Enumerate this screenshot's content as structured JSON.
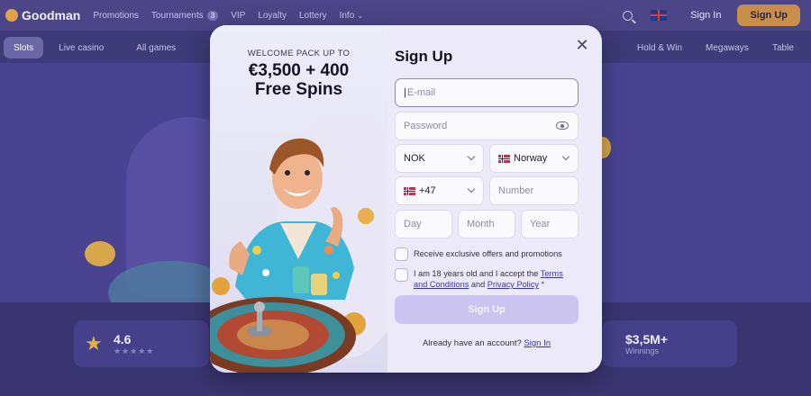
{
  "header": {
    "logo_text": "Goodman",
    "nav": [
      {
        "label": "Promotions"
      },
      {
        "label": "Tournaments",
        "badge": "3"
      },
      {
        "label": "VIP"
      },
      {
        "label": "Loyalty"
      },
      {
        "label": "Lottery"
      },
      {
        "label": "Info"
      }
    ],
    "login_label": "Sign In",
    "signup_label": "Sign Up"
  },
  "categories": [
    "Slots",
    "Live casino",
    "All games",
    "Hold & Win",
    "Megaways",
    "Table"
  ],
  "stats": {
    "rating_value": "4.6",
    "rating_stars": "★★★★★",
    "winnings_value": "$3,5M+",
    "winnings_label": "Winnings"
  },
  "modal": {
    "promo_kicker": "WELCOME PACK UP TO",
    "promo_title_line1": "€3,500 + 400",
    "promo_title_line2": "Free Spins",
    "title": "Sign Up",
    "email_placeholder": "E-mail",
    "password_placeholder": "Password",
    "currency_value": "NOK",
    "country_value": "Norway",
    "phone_code": "+47",
    "number_placeholder": "Number",
    "day_placeholder": "Day",
    "month_placeholder": "Month",
    "year_placeholder": "Year",
    "offers_label": "Receive exclusive offers and promotions",
    "age_text_1": "I am 18 years old and I accept the",
    "terms_link": "Terms and Conditions",
    "age_text_2": "and",
    "privacy_link": "Privacy Policy",
    "required_mark": "*",
    "submit_label": "Sign Up",
    "have_account_text": "Already have an account?",
    "signin_link": "Sign In",
    "close_glyph": "✕"
  },
  "colors": {
    "accent": "#3b34b0",
    "submit_disabled": "#cbc4f0",
    "top_signup": "#c98f4a",
    "page_bg": "#3f3a78"
  },
  "icons": [
    "search-icon",
    "flag-uk-icon",
    "close-icon",
    "eye-icon",
    "chevron-down-icon",
    "flag-norway-icon",
    "star-icon"
  ]
}
